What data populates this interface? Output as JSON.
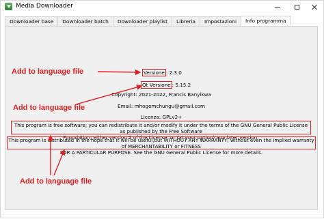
{
  "window": {
    "title": "Media Downloader"
  },
  "tabs": [
    {
      "label": "Downloader base",
      "active": false
    },
    {
      "label": "Downloader batch",
      "active": false
    },
    {
      "label": "Downloader playlist",
      "active": false
    },
    {
      "label": "Libreria",
      "active": false
    },
    {
      "label": "Impostazioni",
      "active": false
    },
    {
      "label": "Info programma",
      "active": true
    }
  ],
  "info": {
    "version_label": "Versione",
    "version_value": ": 2.3.0",
    "qt_label": "Qt Versione",
    "qt_value": ": 5.15.2",
    "copyright": "Copyright: 2021-2022, Francis Banyikwa",
    "email": "Email: mhogomchungu@gmail.com",
    "license": "Licenza: GPLv2+",
    "free_software_line1": "This program is free software; you can redistribute it and/or modify it under the terms of the GNU General Public License as published by the Free Software",
    "free_software_line2": "Foundation; either version 2 of the License, or (at your option) any later version.",
    "warranty_line1": "This program is distributed in the hope that it will be useful,but WITHOUT ANY WARRANTY; without even the implied warranty of MERCHANTABILITY or FITNESS",
    "warranty_line2": "FOR A PARTICULAR PURPOSE.  See the GNU General Public License for more details."
  },
  "annotations": {
    "label_1": "Add to language file",
    "label_2": "Add to language file",
    "label_3": "Add to language file",
    "color": "#e02020"
  }
}
